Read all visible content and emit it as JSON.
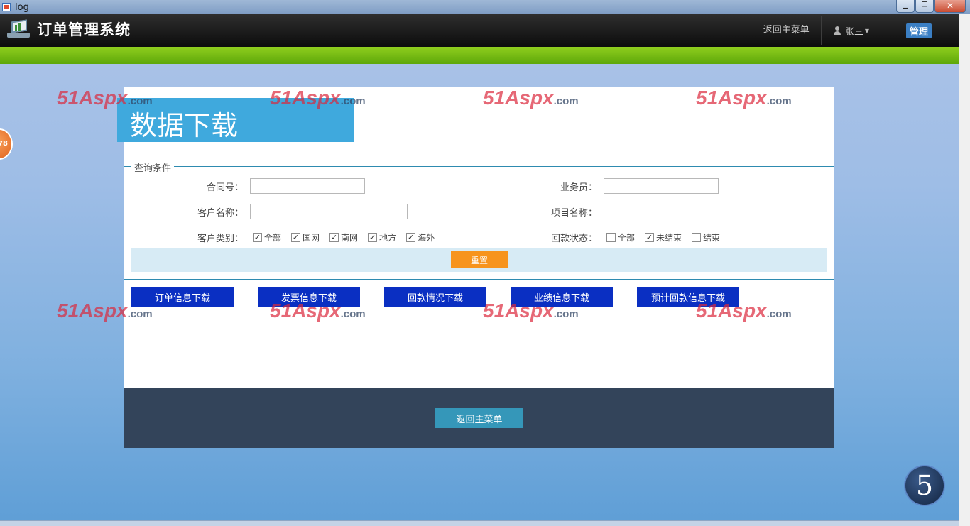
{
  "window": {
    "title": "log",
    "minimize": "▁",
    "maximize": "❐",
    "close": "✕"
  },
  "header": {
    "title": "订单管理系统",
    "back_menu": "返回主菜单",
    "user": "张三",
    "admin": "管理"
  },
  "page": {
    "title": "数据下载",
    "fieldset_legend": "查询条件",
    "fields": {
      "contract_no": {
        "label": "合同号：",
        "value": ""
      },
      "salesman": {
        "label": "业务员：",
        "value": ""
      },
      "customer_name": {
        "label": "客户名称：",
        "value": ""
      },
      "project_name": {
        "label": "项目名称：",
        "value": ""
      }
    },
    "customer_type": {
      "label": "客户类别：",
      "options": [
        {
          "label": "全部",
          "checked": true
        },
        {
          "label": "国网",
          "checked": true
        },
        {
          "label": "南网",
          "checked": true
        },
        {
          "label": "地方",
          "checked": true
        },
        {
          "label": "海外",
          "checked": true
        }
      ]
    },
    "payment_status": {
      "label": "回款状态：",
      "options": [
        {
          "label": "全部",
          "checked": false
        },
        {
          "label": "未结束",
          "checked": true
        },
        {
          "label": "结束",
          "checked": false
        }
      ]
    },
    "reset": "重置",
    "downloads": [
      "订单信息下载",
      "发票信息下载",
      "回款情况下载",
      "业绩信息下载",
      "预计回款信息下载"
    ],
    "back_menu": "返回主菜单"
  },
  "watermark": {
    "main": "51Aspx",
    "domain": ".com"
  },
  "widgets": {
    "side_badge": "78",
    "corner_badge": "5"
  }
}
